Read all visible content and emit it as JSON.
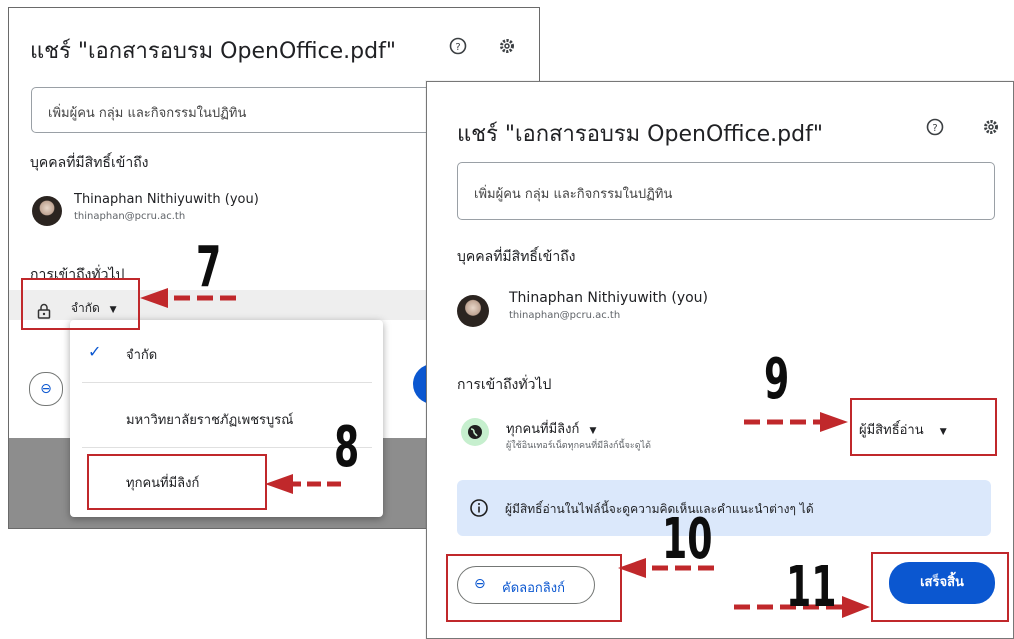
{
  "left": {
    "title": "แชร์ \"เอกสารอบรม OpenOffice.pdf\"",
    "add_placeholder": "เพิ่มผู้คน กลุ่ม และกิจกรรมในปฏิทิน",
    "people_header": "บุคคลที่มีสิทธิ์เข้าถึง",
    "user_name": "Thinaphan Nithiyuwith (you)",
    "user_email": "thinaphan@pcru.ac.th",
    "general_access": "การเข้าถึงทั่วไป",
    "access_value": "จำกัด",
    "menu": [
      "จำกัด",
      "มหาวิทยาลัยราชภัฏเพชรบูรณ์",
      "ทุกคนที่มีลิงก์"
    ]
  },
  "right": {
    "title": "แชร์ \"เอกสารอบรม OpenOffice.pdf\"",
    "add_placeholder": "เพิ่มผู้คน กลุ่ม และกิจกรรมในปฏิทิน",
    "people_header": "บุคคลที่มีสิทธิ์เข้าถึง",
    "user_name": "Thinaphan Nithiyuwith (you)",
    "user_email": "thinaphan@pcru.ac.th",
    "general_access": "การเข้าถึงทั่วไป",
    "access_value": "ทุกคนที่มีลิงก์",
    "access_desc": "ผู้ใช้อินเทอร์เน็ตทุกคนที่มีลิงก์นี้จะดูได้",
    "role": "ผู้มีสิทธิ์อ่าน",
    "info_text": "ผู้มีสิทธิ์อ่านในไฟล์นี้จะดูความคิดเห็นและคำแนะนำต่างๆ ได้",
    "copy_link": "คัดลอกลิงก์",
    "done": "เสร็จสิ้น"
  },
  "steps": [
    "7",
    "8",
    "9",
    "10",
    "11"
  ],
  "colors": {
    "accent": "#0b57d0",
    "annotation": "#c0282b",
    "info_bg": "#dbe8fb"
  },
  "icons": [
    "help-icon",
    "settings-icon",
    "lock-icon",
    "check-icon",
    "link-icon",
    "globe-icon",
    "info-icon",
    "dropdown-arrow-icon"
  ]
}
